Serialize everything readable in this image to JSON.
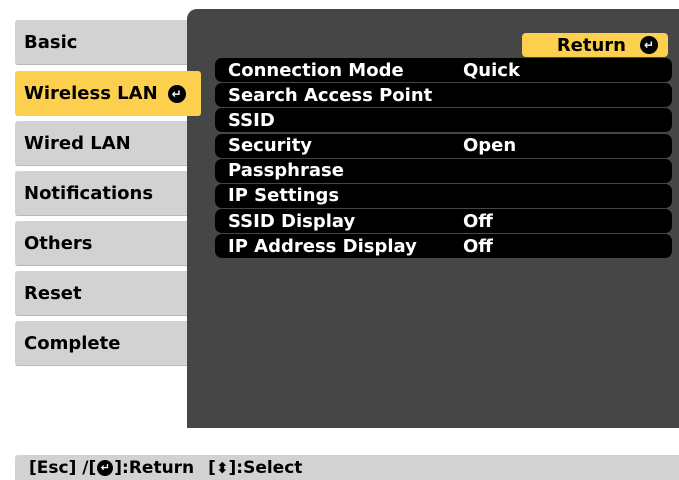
{
  "sidebar": {
    "items": [
      {
        "label": "Basic"
      },
      {
        "label": "Wireless LAN",
        "active": true
      },
      {
        "label": "Wired LAN"
      },
      {
        "label": "Notifications"
      },
      {
        "label": "Others"
      },
      {
        "label": "Reset"
      },
      {
        "label": "Complete"
      }
    ],
    "active_icon": "return-icon"
  },
  "panel": {
    "return_label": "Return",
    "return_icon": "return-icon",
    "rows": [
      {
        "label": "Connection Mode",
        "value": "Quick"
      },
      {
        "label": "Search Access Point",
        "value": ""
      },
      {
        "label": "SSID",
        "value": ""
      },
      {
        "label": "Security",
        "value": "Open"
      },
      {
        "label": "Passphrase",
        "value": ""
      },
      {
        "label": "IP Settings",
        "value": ""
      },
      {
        "label": "SSID Display",
        "value": "Off"
      },
      {
        "label": "IP Address Display",
        "value": "Off"
      }
    ]
  },
  "status_bar": {
    "esc_text": "[Esc] /[",
    "return_text": "]:Return",
    "select_open": "[",
    "select_symbol": "⬍",
    "select_text": "]:Select"
  },
  "colors": {
    "accent": "#fccf4f",
    "menu_bg": "#d2d2d2",
    "panel_bg": "#464646",
    "row_bg": "#000000"
  }
}
